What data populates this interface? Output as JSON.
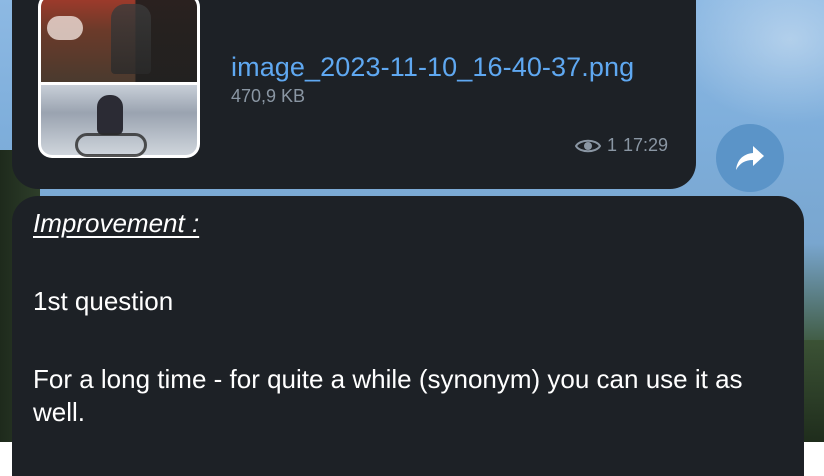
{
  "file_message": {
    "file_name": "image_2023-11-10_16-40-37.png",
    "file_size": "470,9 KB",
    "views": "1",
    "time": "17:29",
    "eye_icon": "eye-icon",
    "thumbnail_icon": "image-thumbnail"
  },
  "share_button": {
    "icon": "share-arrow-icon",
    "color": "#5b94c8"
  },
  "text_message": {
    "heading": "Improvement :",
    "question": "1st question",
    "body": "For a long time - for quite a while (synonym) you can use it as well."
  },
  "colors": {
    "bubble": "#1d2126",
    "link": "#5fa8f1",
    "meta": "#8a96a3"
  }
}
